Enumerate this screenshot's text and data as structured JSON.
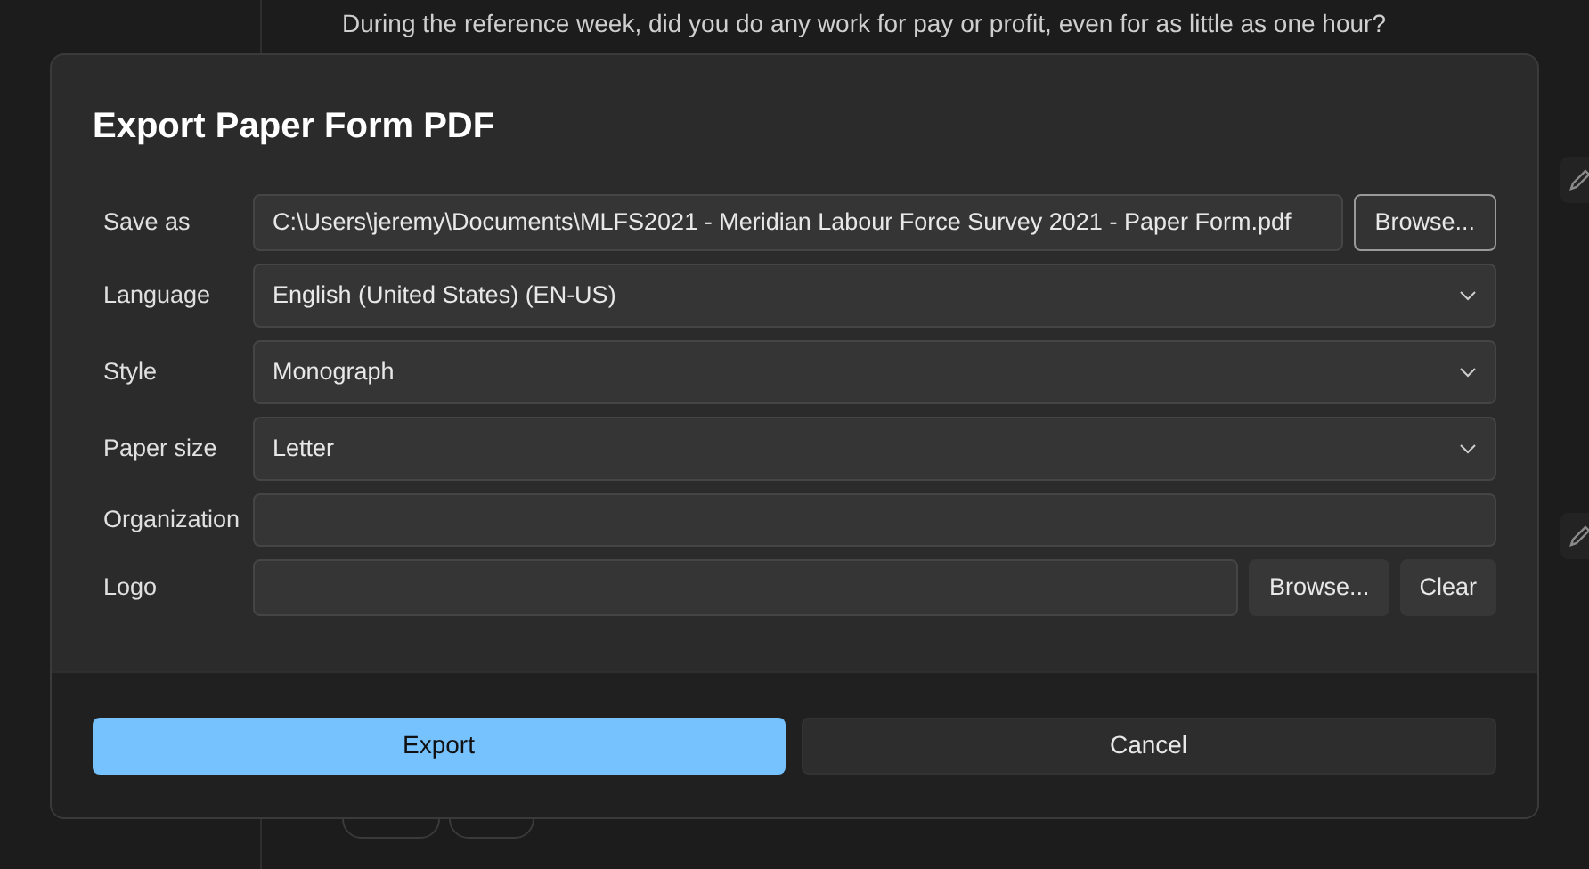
{
  "background": {
    "question": "During the reference week, did you do any work for pay or profit, even for as little as one hour?"
  },
  "dialog": {
    "title": "Export Paper Form PDF",
    "fields": [
      {
        "kind": "file",
        "label": "Save as",
        "value": "C:\\Users\\jeremy\\Documents\\MLFS2021 - Meridian Labour Force Survey 2021 - Paper Form.pdf",
        "buttons": [
          "Browse..."
        ]
      },
      {
        "kind": "select",
        "label": "Language",
        "value": "English (United States) (EN-US)"
      },
      {
        "kind": "select",
        "label": "Style",
        "value": "Monograph"
      },
      {
        "kind": "select",
        "label": "Paper size",
        "value": "Letter"
      },
      {
        "kind": "text",
        "label": "Organization"
      },
      {
        "kind": "image",
        "label": "Logo",
        "buttons": [
          "Browse...",
          "Clear"
        ]
      }
    ],
    "buttons": [
      {
        "label": "Export",
        "kind": "primary"
      },
      {
        "label": "Cancel",
        "kind": "secondary"
      }
    ]
  }
}
